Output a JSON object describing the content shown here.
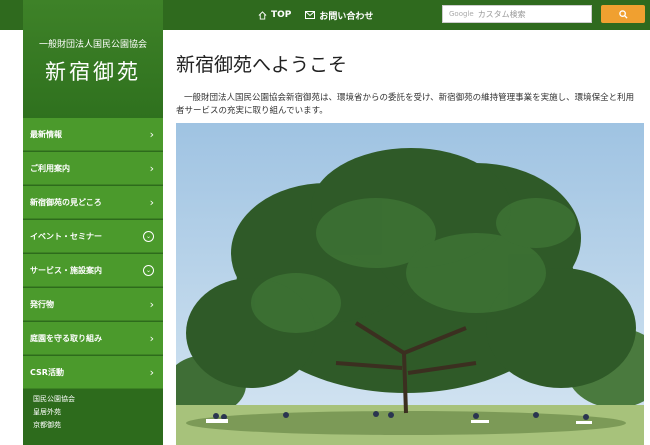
{
  "topnav": {
    "top_label": "TOP",
    "contact_label": "お問い合わせ"
  },
  "search": {
    "placeholder": "カスタム検索",
    "google_label": "Google"
  },
  "brand": {
    "org": "一般財団法人国民公園協会",
    "site": "新宿御苑"
  },
  "sidebar": {
    "items": [
      {
        "label": "最新情報",
        "indicator": "›"
      },
      {
        "label": "ご利用案内",
        "indicator": "›"
      },
      {
        "label": "新宿御苑の見どころ",
        "indicator": "›"
      },
      {
        "label": "イベント・セミナー",
        "indicator": "⌄"
      },
      {
        "label": "サービス・施設案内",
        "indicator": "⌄"
      },
      {
        "label": "発行物",
        "indicator": "›"
      },
      {
        "label": "庭園を守る取り組み",
        "indicator": "›"
      },
      {
        "label": "CSR活動",
        "indicator": "›"
      }
    ],
    "sub_links": [
      "国民公園協会",
      "皇居外苑",
      "京都御苑"
    ]
  },
  "main": {
    "title": "新宿御苑へようこそ",
    "intro": "一般財団法人国民公園協会新宿御苑は、環境省からの委託を受け、新宿御苑の維持管理事業を実施し、環境保全と利用者サービスの充実に取り組んでいます。"
  },
  "colors": {
    "header": "#2f6a1e",
    "menu": "#4b9a2c",
    "accent": "#f0a030"
  },
  "icons": {
    "top": "home-icon",
    "contact": "mail-icon",
    "search": "search-icon"
  }
}
